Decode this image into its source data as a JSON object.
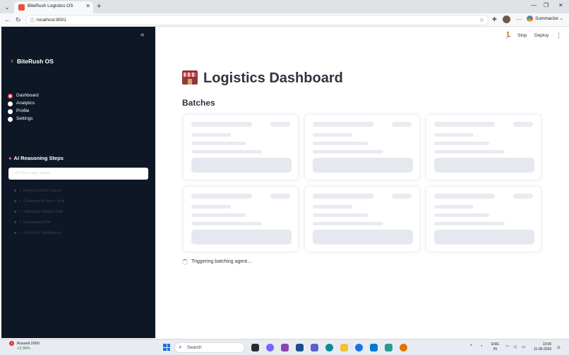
{
  "browser": {
    "tab_title": "BiteRush Logistics OS",
    "tab_close": "✕",
    "new_tab": "+",
    "url": "localhost:8501",
    "summarize_label": "Summarize",
    "minimize": "—",
    "restore": "❐",
    "close": "✕"
  },
  "sidebar": {
    "brand": "BiteRush OS",
    "nav": [
      {
        "label": "Dashboard",
        "selected": true
      },
      {
        "label": "Analytics",
        "selected": false
      },
      {
        "label": "Profile",
        "selected": false
      },
      {
        "label": "Settings",
        "selected": false
      }
    ],
    "reasoning_title": "AI Reasoning Steps",
    "status_text": "⟳ Flow Logic Stable",
    "steps": [
      "✓ Analyzing Order Queue",
      "✓ Clustering by Floor / Seat",
      "✓ Optimizing Delivery Path",
      "✓ Generating ETAs",
      "✓ Syncing to Dashboards"
    ]
  },
  "toolbar": {
    "stop": "Stop",
    "deploy": "Deploy",
    "menu": "⋮"
  },
  "main": {
    "title": "Logistics Dashboard",
    "section": "Batches",
    "loading_text": "Triggering batching agent..."
  },
  "taskbar": {
    "stock_name": "Russell 2000",
    "stock_change": "+2.96%",
    "stock_badge": "3",
    "search": "Search",
    "lang_top": "ENG",
    "lang_bottom": "IN",
    "time": "13:06",
    "date": "11-06-2026"
  }
}
